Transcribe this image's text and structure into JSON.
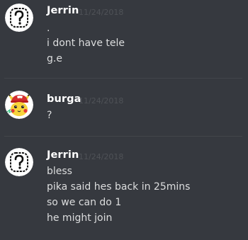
{
  "messages": [
    {
      "author": "Jerrin",
      "timestamp": "11/24/2018",
      "avatar_icon": "question-mark-avatar-icon",
      "lines": [
        ".",
        "i dont have tele",
        "g.e"
      ]
    },
    {
      "author": "burga",
      "timestamp": "11/24/2018",
      "avatar_icon": "pikachu-avatar-icon",
      "lines": [
        "?"
      ]
    },
    {
      "author": "Jerrin",
      "timestamp": "11/24/2018",
      "avatar_icon": "question-mark-avatar-icon",
      "lines": [
        "bless",
        "pika said hes back in 25mins",
        "so we can do 1",
        "he might join"
      ]
    }
  ],
  "colors": {
    "background": "#36393f",
    "username": "#ffffff",
    "message_text": "#dcddde",
    "timestamp": "#4f5257",
    "divider": "#42454a"
  }
}
